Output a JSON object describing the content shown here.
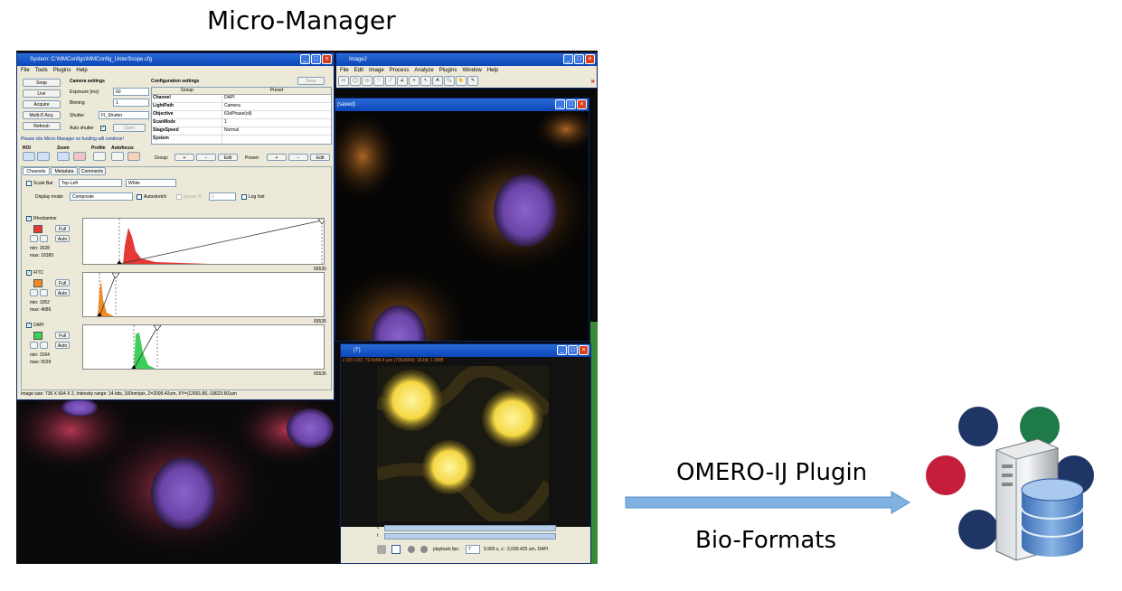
{
  "diagram": {
    "left_title": "Micro-Manager",
    "arrow_label_top": "OMERO-IJ Plugin",
    "arrow_label_bottom": "Bio-Formats",
    "colors": {
      "arrow": "#7fb2e0",
      "circle_navy": "#1f3566",
      "circle_green": "#1f7a4a",
      "circle_red": "#c41e3a",
      "database": "#6c9ad3"
    }
  },
  "micromanager": {
    "window_title": "System: C:\\MMConfigs\\MMConfig_UnterScope.cfg",
    "menu": [
      "File",
      "Tools",
      "Plugins",
      "Help"
    ],
    "save_label": "Save",
    "buttons": {
      "snap": "Snap",
      "live": "Live",
      "acquire": "Acquire",
      "mda": "Multi-D Acq.",
      "refresh": "Refresh",
      "open": "Open"
    },
    "camera_settings": "Camera settings",
    "exposure_label": "Exposure [ms]",
    "exposure_value": "60",
    "binning_label": "Binning",
    "binning_value": "1",
    "shutter_label": "Shutter",
    "shutter_value": "FI_Shutter",
    "auto_shutter_label": "Auto shutter",
    "config_title": "Configuration settings",
    "config_headers": [
      "Group",
      "Preset"
    ],
    "config_rows": [
      {
        "group": "Channel",
        "preset": "DAPI"
      },
      {
        "group": "LightPath",
        "preset": "Camera"
      },
      {
        "group": "Objective",
        "preset": "63xPhase(oil)"
      },
      {
        "group": "ScanMode",
        "preset": "1"
      },
      {
        "group": "StageSpeed",
        "preset": "Normal"
      },
      {
        "group": "System",
        "preset": ""
      }
    ],
    "cite_notice": "Please cite Micro-Manager so funding will continue!",
    "tool_labels": {
      "roi": "ROI",
      "zoom": "Zoom",
      "profile": "Profile",
      "autofocus": "Autofocus"
    },
    "group_label": "Group:",
    "preset_label": "Preset:",
    "edit_label": "Edit",
    "tabs": [
      "Channels",
      "Metadata",
      "Comments"
    ],
    "scale_bar_label": "Scale Bar",
    "scale_bar_position": "Top-Left",
    "scale_bar_color": "White",
    "display_mode_label": "Display mode:",
    "display_mode_value": "Composite",
    "autostretch_label": "Autostretch",
    "ignore_label": "Ignore %",
    "ignore_value": "0",
    "loghist_label": "Log hist",
    "channels": [
      {
        "name": "Rhodamine",
        "color": "#e53935",
        "min": "min: 2628",
        "max": "max: 16383"
      },
      {
        "name": "FITC",
        "color": "#ef8a24",
        "min": "min: 1052",
        "max": "max: 4686"
      },
      {
        "name": "DAPI",
        "color": "#3ccf5a",
        "min": "min: 3164",
        "max": "max: 5539"
      }
    ],
    "full_label": "Full",
    "auto_label": "Auto",
    "hist_max": "65535",
    "status": "Image size: 736 X 664 X 2, Intensity range: 14 bits, 100nm/pix, Z=2099.42um, XY=(12691.80,-18623.60)um"
  },
  "imagej": {
    "title": "ImageJ",
    "menu": [
      "File",
      "Edit",
      "Image",
      "Process",
      "Analyze",
      "Plugins",
      "Window",
      "Help"
    ],
    "tools": [
      "▭",
      "◯",
      "◇",
      "♡",
      "⟋",
      "∠",
      "+",
      "↖",
      "A",
      "🔍",
      "✋",
      "✎"
    ]
  },
  "image_window": {
    "title": "(saved)"
  },
  "stack_window": {
    "title": "(T)",
    "info": "c:2/3 t:2/2; 73.6x66.4 µm (736x664); 16-bit; 1.9MB",
    "playback_label": "playback fps:",
    "fps": "7",
    "readout": "9.965 s, z: -2,099.425 um, DAPI",
    "c_label": "c",
    "t_label": "t"
  }
}
